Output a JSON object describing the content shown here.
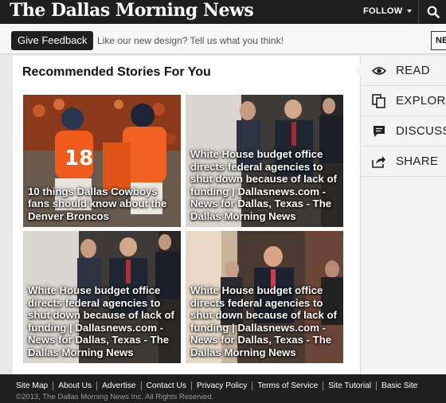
{
  "header": {
    "logo_text": "The Dallas Morning News",
    "follow_label": "FOLLOW"
  },
  "feedback": {
    "button_label": "Give Feedback",
    "prompt": "Like our new design? Tell us what you think!",
    "right_button_label": "NE"
  },
  "main": {
    "section_title": "Recommended Stories For You",
    "stories": [
      {
        "caption": "10 things Dallas Cowboys fans should know about the Denver Broncos",
        "image": "football-players-photo"
      },
      {
        "caption": "White House budget office directs federal agencies to shut down because of lack of funding | Dallasnews.com - News for Dallas, Texas - The Dallas Morning News",
        "image": "politicians-photo"
      },
      {
        "caption": "White House budget office directs federal agencies to shut down because of lack of funding | Dallasnews.com - News for Dallas, Texas - The Dallas Morning News",
        "image": "politicians-photo"
      },
      {
        "caption": "White House budget office directs federal agencies to shut down because of lack of funding | Dallasnews.com - News for Dallas, Texas - The Dallas Morning News",
        "image": "politicians-hallway-photo"
      }
    ]
  },
  "sidebar": {
    "items": [
      {
        "label": "READ",
        "icon": "eye-icon"
      },
      {
        "label": "EXPLORE",
        "icon": "copy-icon"
      },
      {
        "label": "DISCUSS",
        "icon": "comment-icon"
      },
      {
        "label": "SHARE",
        "icon": "share-icon"
      }
    ]
  },
  "footer": {
    "links": [
      "Site Map",
      "About Us",
      "Advertise",
      "Contact Us",
      "Privacy Policy",
      "Terms of Service",
      "Site Tutorial",
      "Basic Site"
    ],
    "copyright": "©2013, The Dallas Morning News Inc. All Rights Reserved."
  },
  "colors": {
    "topbar": "#1f1f1f",
    "broncos_orange": "#f05a1a",
    "footer": "#1f1f1f"
  }
}
